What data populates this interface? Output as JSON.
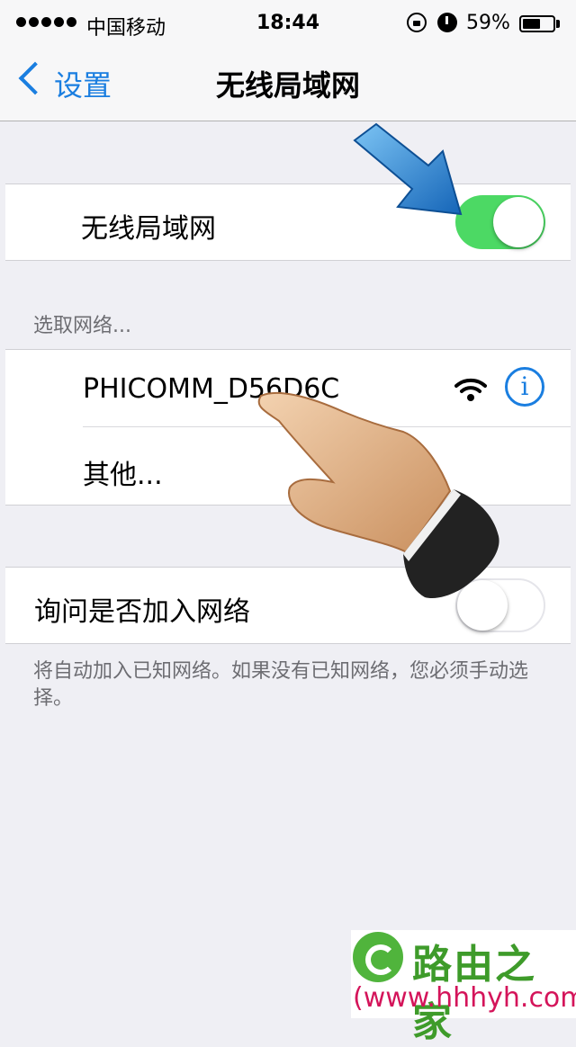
{
  "status_bar": {
    "carrier": "中国移动",
    "time": "18:44",
    "battery_percent": "59%",
    "battery_level": 0.59,
    "icons": [
      "signal-dots-icon",
      "rotation-lock-icon",
      "alarm-icon",
      "battery-icon"
    ]
  },
  "nav": {
    "back_label": "设置",
    "title": "无线局域网"
  },
  "wifi_section": {
    "label": "无线局域网",
    "enabled": true
  },
  "network_section": {
    "header": "选取网络...",
    "networks": [
      {
        "name": "PHICOMM_D56D6C"
      }
    ],
    "other_label": "其他..."
  },
  "ask_section": {
    "label": "询问是否加入网络",
    "enabled": false,
    "footer": "将自动加入已知网络。如果没有已知网络，您必须手动选择。"
  },
  "watermark": {
    "title": "路由之家",
    "url": "(www.hhhyh.com)"
  },
  "colors": {
    "accent_blue": "#1a7ee0",
    "toggle_on_green": "#4cd964",
    "background": "#efeff4"
  }
}
